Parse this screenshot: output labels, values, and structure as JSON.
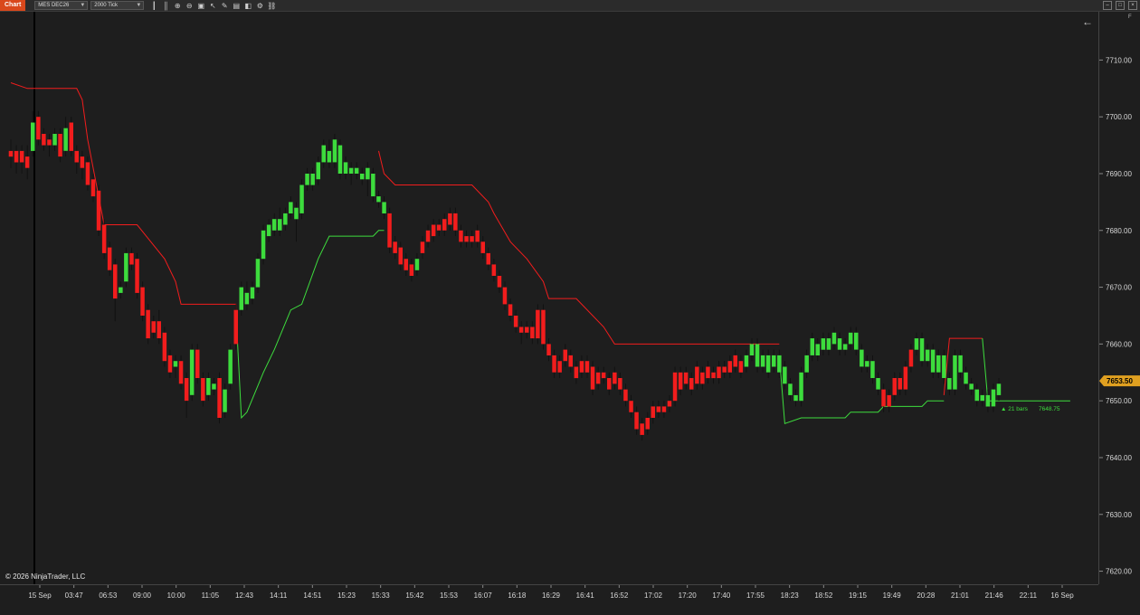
{
  "toolbar": {
    "chart_tab": "Chart",
    "instrument": "MES DEC26",
    "interval": "2000 Tick"
  },
  "panel": {
    "f_label": "F"
  },
  "copyright": "© 2026 NinjaTrader, LLC",
  "colors": {
    "up": "#3ddc3d",
    "down": "#f21d1d",
    "background": "#1e1e1e",
    "price_marker": "#e0a020"
  },
  "chart_data": {
    "type": "candlestick",
    "price_axis": {
      "ticks": [
        "7710.00",
        "7700.00",
        "7690.00",
        "7680.00",
        "7670.00",
        "7660.00",
        "7650.00",
        "7640.00",
        "7630.00",
        "7620.00"
      ],
      "ylim": [
        7617.7,
        7718.5
      ]
    },
    "time_axis": {
      "ticks": [
        "15 Sep",
        "03:47",
        "06:53",
        "09:00",
        "10:00",
        "11:05",
        "12:43",
        "14:11",
        "14:51",
        "15:23",
        "15:33",
        "15:42",
        "15:53",
        "16:07",
        "16:18",
        "16:29",
        "16:41",
        "16:52",
        "17:02",
        "17:20",
        "17:40",
        "17:55",
        "18:23",
        "18:52",
        "19:15",
        "19:49",
        "20:28",
        "21:01",
        "21:46",
        "22:11",
        "16 Sep"
      ]
    },
    "last_price": "7653.50",
    "annotation": {
      "bars": "▲ 21 bars",
      "price": "7648.75"
    },
    "candles": [
      [
        7694,
        7693,
        7696,
        7691,
        "d"
      ],
      [
        7694,
        7692,
        7695,
        7690,
        "d"
      ],
      [
        7694,
        7692,
        7695,
        7690,
        "d"
      ],
      [
        7693,
        7691,
        7695,
        7689,
        "d"
      ],
      [
        7694,
        7699,
        7701,
        7693,
        "u"
      ],
      [
        7700,
        7696,
        7701,
        7695,
        "d"
      ],
      [
        7697,
        7695,
        7698,
        7694,
        "d"
      ],
      [
        7696,
        7695,
        7697,
        7693,
        "d"
      ],
      [
        7695,
        7697,
        7698,
        7694,
        "u"
      ],
      [
        7697,
        7693,
        7698,
        7692,
        "d"
      ],
      [
        7694,
        7698,
        7700,
        7693,
        "u"
      ],
      [
        7699,
        7694,
        7700,
        7693,
        "d"
      ],
      [
        7694,
        7692,
        7695,
        7690,
        "d"
      ],
      [
        7693,
        7691,
        7694,
        7689,
        "d"
      ],
      [
        7692,
        7688,
        7693,
        7687,
        "d"
      ],
      [
        7689,
        7686,
        7690,
        7685,
        "d"
      ],
      [
        7687,
        7680,
        7688,
        7679,
        "d"
      ],
      [
        7681,
        7676,
        7682,
        7675,
        "d"
      ],
      [
        7677,
        7673,
        7678,
        7672,
        "d"
      ],
      [
        7674,
        7668,
        7675,
        7664,
        "d"
      ],
      [
        7669,
        7670,
        7671,
        7668,
        "u"
      ],
      [
        7671,
        7676,
        7677,
        7670,
        "u"
      ],
      [
        7676,
        7674,
        7677,
        7673,
        "d"
      ],
      [
        7675,
        7669,
        7676,
        7668,
        "d"
      ],
      [
        7670,
        7665,
        7671,
        7664,
        "d"
      ],
      [
        7666,
        7661,
        7667,
        7660,
        "d"
      ],
      [
        7662,
        7664,
        7665,
        7661,
        "d"
      ],
      [
        7664,
        7661,
        7666,
        7660,
        "d"
      ],
      [
        7662,
        7657,
        7663,
        7656,
        "d"
      ],
      [
        7658,
        7655,
        7659,
        7654,
        "d"
      ],
      [
        7656,
        7657,
        7658,
        7654,
        "u"
      ],
      [
        7657,
        7653,
        7658,
        7652,
        "d"
      ],
      [
        7654,
        7650,
        7655,
        7647,
        "d"
      ],
      [
        7651,
        7659,
        7660,
        7650,
        "u"
      ],
      [
        7659,
        7654,
        7660,
        7653,
        "d"
      ],
      [
        7654,
        7650,
        7655,
        7649,
        "d"
      ],
      [
        7651,
        7654,
        7655,
        7650,
        "u"
      ],
      [
        7653,
        7652,
        7654,
        7651,
        "u"
      ],
      [
        7654,
        7647,
        7655,
        7646,
        "d"
      ],
      [
        7648,
        7652,
        7653,
        7647,
        "u"
      ],
      [
        7653,
        7659,
        7660,
        7652,
        "u"
      ],
      [
        7660,
        7666,
        7667,
        7659,
        "d"
      ],
      [
        7666,
        7670,
        7671,
        7665,
        "u"
      ],
      [
        7669,
        7667,
        7671,
        7666,
        "u"
      ],
      [
        7668,
        7670,
        7671,
        7667,
        "u"
      ],
      [
        7670,
        7675,
        7676,
        7669,
        "u"
      ],
      [
        7675,
        7680,
        7681,
        7674,
        "u"
      ],
      [
        7679,
        7681,
        7682,
        7678,
        "u"
      ],
      [
        7680,
        7682,
        7683,
        7679,
        "u"
      ],
      [
        7682,
        7680,
        7684,
        7679,
        "u"
      ],
      [
        7681,
        7683,
        7684,
        7680,
        "u"
      ],
      [
        7683,
        7685,
        7686,
        7682,
        "u"
      ],
      [
        7684,
        7682,
        7685,
        7678,
        "u"
      ],
      [
        7683,
        7688,
        7689,
        7682,
        "u"
      ],
      [
        7688,
        7690,
        7691,
        7687,
        "u"
      ],
      [
        7690,
        7688,
        7691,
        7687,
        "u"
      ],
      [
        7689,
        7692,
        7693,
        7688,
        "u"
      ],
      [
        7692,
        7695,
        7696,
        7691,
        "u"
      ],
      [
        7694,
        7692,
        7696,
        7691,
        "u"
      ],
      [
        7692,
        7696,
        7697,
        7691,
        "u"
      ],
      [
        7695,
        7690,
        7696,
        7689,
        "u"
      ],
      [
        7690,
        7692,
        7693,
        7689,
        "u"
      ],
      [
        7691,
        7690,
        7692,
        7688,
        "u"
      ],
      [
        7690,
        7691,
        7692,
        7689,
        "u"
      ],
      [
        7690,
        7689,
        7691,
        7688,
        "u"
      ],
      [
        7691,
        7689,
        7692,
        7686,
        "u"
      ],
      [
        7690,
        7686,
        7691,
        7685,
        "u"
      ],
      [
        7686,
        7685,
        7687,
        7684,
        "u"
      ],
      [
        7685,
        7683,
        7686,
        7682,
        "u"
      ],
      [
        7683,
        7677,
        7684,
        7676,
        "d"
      ],
      [
        7678,
        7676,
        7679,
        7675,
        "d"
      ],
      [
        7677,
        7674,
        7678,
        7673,
        "d"
      ],
      [
        7675,
        7673,
        7676,
        7672,
        "d"
      ],
      [
        7674,
        7672,
        7675,
        7671,
        "d"
      ],
      [
        7673,
        7675,
        7676,
        7672,
        "u"
      ],
      [
        7676,
        7678,
        7679,
        7675,
        "d"
      ],
      [
        7678,
        7680,
        7681,
        7677,
        "d"
      ],
      [
        7679,
        7681,
        7682,
        7678,
        "d"
      ],
      [
        7681,
        7680,
        7682,
        7679,
        "d"
      ],
      [
        7680,
        7682,
        7683,
        7679,
        "d"
      ],
      [
        7681,
        7683,
        7684,
        7680,
        "d"
      ],
      [
        7683,
        7680,
        7684,
        7679,
        "d"
      ],
      [
        7680,
        7678,
        7681,
        7677,
        "d"
      ],
      [
        7678,
        7679,
        7680,
        7677,
        "d"
      ],
      [
        7679,
        7678,
        7680,
        7677,
        "d"
      ],
      [
        7680,
        7678,
        7681,
        7677,
        "d"
      ],
      [
        7678,
        7676,
        7679,
        7675,
        "d"
      ],
      [
        7676,
        7674,
        7677,
        7673,
        "d"
      ],
      [
        7674,
        7672,
        7675,
        7671,
        "d"
      ],
      [
        7672,
        7670,
        7673,
        7669,
        "d"
      ],
      [
        7670,
        7667,
        7671,
        7666,
        "d"
      ],
      [
        7667,
        7665,
        7668,
        7664,
        "d"
      ],
      [
        7665,
        7663,
        7666,
        7662,
        "d"
      ],
      [
        7663,
        7662,
        7664,
        7660,
        "d"
      ],
      [
        7662,
        7663,
        7664,
        7661,
        "d"
      ],
      [
        7663,
        7661,
        7664,
        7660,
        "d"
      ],
      [
        7661,
        7666,
        7667,
        7660,
        "d"
      ],
      [
        7666,
        7660,
        7667,
        7659,
        "d"
      ],
      [
        7660,
        7658,
        7661,
        7657,
        "d"
      ],
      [
        7658,
        7655,
        7659,
        7654,
        "d"
      ],
      [
        7655,
        7657,
        7658,
        7654,
        "d"
      ],
      [
        7657,
        7659,
        7660,
        7656,
        "d"
      ],
      [
        7658,
        7656,
        7659,
        7655,
        "d"
      ],
      [
        7656,
        7654,
        7657,
        7653,
        "d"
      ],
      [
        7655,
        7657,
        7658,
        7654,
        "d"
      ],
      [
        7657,
        7655,
        7658,
        7654,
        "d"
      ],
      [
        7656,
        7652,
        7657,
        7651,
        "d"
      ],
      [
        7653,
        7655,
        7656,
        7652,
        "d"
      ],
      [
        7655,
        7654,
        7656,
        7653,
        "d"
      ],
      [
        7654,
        7652,
        7655,
        7651,
        "d"
      ],
      [
        7653,
        7655,
        7656,
        7652,
        "d"
      ],
      [
        7654,
        7652,
        7655,
        7651,
        "d"
      ],
      [
        7652,
        7650,
        7653,
        7649,
        "d"
      ],
      [
        7650,
        7648,
        7651,
        7647,
        "d"
      ],
      [
        7648,
        7645,
        7649,
        7644,
        "d"
      ],
      [
        7646,
        7644,
        7647,
        7643,
        "d"
      ],
      [
        7645,
        7647,
        7648,
        7644,
        "d"
      ],
      [
        7647,
        7649,
        7650,
        7646,
        "d"
      ],
      [
        7649,
        7648,
        7650,
        7647,
        "d"
      ],
      [
        7648,
        7649,
        7650,
        7647,
        "d"
      ],
      [
        7649,
        7650,
        7651,
        7648,
        "d"
      ],
      [
        7650,
        7655,
        7656,
        7649,
        "d"
      ],
      [
        7655,
        7652,
        7656,
        7651,
        "d"
      ],
      [
        7653,
        7655,
        7656,
        7652,
        "d"
      ],
      [
        7654,
        7652,
        7655,
        7651,
        "d"
      ],
      [
        7653,
        7656,
        7657,
        7652,
        "d"
      ],
      [
        7655,
        7653,
        7656,
        7652,
        "d"
      ],
      [
        7654,
        7656,
        7657,
        7653,
        "d"
      ],
      [
        7655,
        7654,
        7656,
        7653,
        "d"
      ],
      [
        7654,
        7656,
        7657,
        7653,
        "d"
      ],
      [
        7656,
        7655,
        7657,
        7654,
        "d"
      ],
      [
        7655,
        7657,
        7658,
        7654,
        "d"
      ],
      [
        7656,
        7658,
        7659,
        7655,
        "d"
      ],
      [
        7657,
        7655,
        7658,
        7654,
        "d"
      ],
      [
        7656,
        7658,
        7659,
        7655,
        "u"
      ],
      [
        7658,
        7660,
        7661,
        7657,
        "u"
      ],
      [
        7660,
        7656,
        7661,
        7655,
        "u"
      ],
      [
        7656,
        7658,
        7659,
        7655,
        "u"
      ],
      [
        7658,
        7655,
        7659,
        7654,
        "u"
      ],
      [
        7656,
        7658,
        7659,
        7655,
        "u"
      ],
      [
        7658,
        7655,
        7659,
        7654,
        "u"
      ],
      [
        7656,
        7653,
        7657,
        7652,
        "u"
      ],
      [
        7653,
        7651,
        7654,
        7650,
        "u"
      ],
      [
        7651,
        7650,
        7652,
        7649,
        "u"
      ],
      [
        7650,
        7655,
        7656,
        7649,
        "u"
      ],
      [
        7655,
        7658,
        7659,
        7654,
        "u"
      ],
      [
        7658,
        7661,
        7662,
        7657,
        "u"
      ],
      [
        7660,
        7658,
        7661,
        7657,
        "u"
      ],
      [
        7659,
        7661,
        7662,
        7658,
        "u"
      ],
      [
        7661,
        7659,
        7662,
        7658,
        "u"
      ],
      [
        7660,
        7662,
        7663,
        7659,
        "u"
      ],
      [
        7661,
        7659,
        7662,
        7658,
        "u"
      ],
      [
        7659,
        7660,
        7661,
        7658,
        "u"
      ],
      [
        7660,
        7662,
        7663,
        7659,
        "u"
      ],
      [
        7662,
        7659,
        7663,
        7658,
        "u"
      ],
      [
        7659,
        7656,
        7660,
        7655,
        "u"
      ],
      [
        7656,
        7657,
        7658,
        7655,
        "u"
      ],
      [
        7657,
        7654,
        7658,
        7653,
        "u"
      ],
      [
        7654,
        7652,
        7655,
        7651,
        "u"
      ],
      [
        7652,
        7649,
        7653,
        7648,
        "d"
      ],
      [
        7649,
        7651,
        7652,
        7648,
        "d"
      ],
      [
        7651,
        7654,
        7655,
        7650,
        "d"
      ],
      [
        7654,
        7652,
        7655,
        7651,
        "d"
      ],
      [
        7652,
        7656,
        7657,
        7651,
        "d"
      ],
      [
        7656,
        7659,
        7660,
        7655,
        "d"
      ],
      [
        7659,
        7661,
        7662,
        7658,
        "u"
      ],
      [
        7661,
        7657,
        7662,
        7656,
        "u"
      ],
      [
        7657,
        7659,
        7660,
        7656,
        "u"
      ],
      [
        7659,
        7655,
        7660,
        7654,
        "u"
      ],
      [
        7655,
        7658,
        7659,
        7654,
        "u"
      ],
      [
        7658,
        7654,
        7659,
        7653,
        "u"
      ],
      [
        7654,
        7652,
        7655,
        7651,
        "u"
      ],
      [
        7652,
        7658,
        7659,
        7651,
        "u"
      ],
      [
        7658,
        7655,
        7659,
        7654,
        "u"
      ],
      [
        7655,
        7653,
        7656,
        7652,
        "u"
      ],
      [
        7653,
        7652,
        7654,
        7651,
        "u"
      ],
      [
        7652,
        7650,
        7653,
        7649,
        "u"
      ],
      [
        7650,
        7651,
        7652,
        7649,
        "u"
      ],
      [
        7651,
        7649,
        7652,
        7648,
        "u"
      ],
      [
        7649,
        7652,
        7653,
        7648,
        "u"
      ],
      [
        7651,
        7653,
        7654,
        7650,
        "u"
      ]
    ],
    "supertrend_down": [
      [
        0,
        7706
      ],
      [
        3,
        7705
      ],
      [
        12,
        7705
      ],
      [
        13,
        7703
      ],
      [
        14,
        7696
      ],
      [
        17,
        7681
      ],
      [
        23,
        7681
      ],
      [
        28,
        7675
      ],
      [
        30,
        7671
      ],
      [
        31,
        7667
      ],
      [
        41,
        7667
      ],
      [
        41,
        7665
      ]
    ],
    "supertrend_up": [
      [
        41,
        7666
      ],
      [
        42,
        7647
      ],
      [
        43,
        7648
      ],
      [
        46,
        7655
      ],
      [
        48,
        7659
      ],
      [
        51,
        7666
      ],
      [
        53,
        7667
      ],
      [
        56,
        7675
      ],
      [
        58,
        7679
      ],
      [
        66,
        7679
      ],
      [
        67,
        7680
      ],
      [
        68,
        7680
      ]
    ],
    "supertrend_down2": [
      [
        67,
        7694
      ],
      [
        68,
        7690
      ],
      [
        70,
        7688
      ],
      [
        84,
        7688
      ],
      [
        87,
        7685
      ],
      [
        88,
        7683
      ],
      [
        91,
        7678
      ],
      [
        94,
        7675
      ],
      [
        97,
        7671
      ],
      [
        98,
        7668
      ],
      [
        103,
        7668
      ],
      [
        108,
        7663
      ],
      [
        110,
        7660
      ],
      [
        140,
        7660
      ]
    ],
    "supertrend_up2": [
      [
        140,
        7658
      ],
      [
        141,
        7646
      ],
      [
        144,
        7647
      ],
      [
        152,
        7647
      ],
      [
        153,
        7648
      ],
      [
        158,
        7648
      ],
      [
        159,
        7649
      ],
      [
        166,
        7649
      ],
      [
        167,
        7650
      ],
      [
        170,
        7650
      ]
    ],
    "supertrend_down3": [
      [
        170,
        7651
      ],
      [
        171,
        7661
      ],
      [
        177,
        7661
      ]
    ],
    "supertrend_up3": [
      [
        177,
        7661
      ],
      [
        178,
        7650
      ],
      [
        193,
        7650
      ]
    ]
  }
}
